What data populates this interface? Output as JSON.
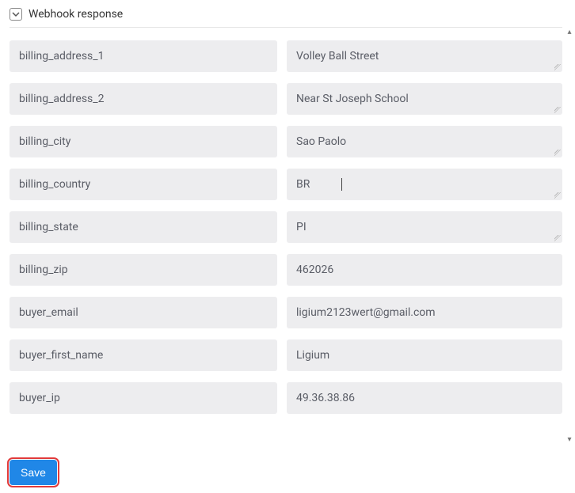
{
  "header": {
    "title": "Webhook response"
  },
  "rows": [
    {
      "key": "billing_address_1",
      "value": "Volley Ball Street",
      "resize": true
    },
    {
      "key": "billing_address_2",
      "value": "Near St Joseph School",
      "resize": true
    },
    {
      "key": "billing_city",
      "value": "Sao Paolo",
      "resize": true
    },
    {
      "key": "billing_country",
      "value": "BR",
      "resize": true,
      "caret": true
    },
    {
      "key": "billing_state",
      "value": "PI",
      "resize": true
    },
    {
      "key": "billing_zip",
      "value": "462026",
      "resize": false
    },
    {
      "key": "buyer_email",
      "value": "ligium2123wert@gmail.com",
      "resize": false
    },
    {
      "key": "buyer_first_name",
      "value": "Ligium",
      "resize": false
    },
    {
      "key": "buyer_ip",
      "value": "49.36.38.86",
      "resize": false
    }
  ],
  "footer": {
    "save_label": "Save"
  }
}
